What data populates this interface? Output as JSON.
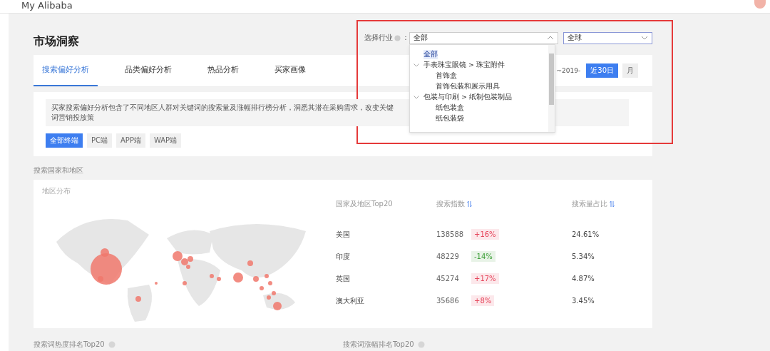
{
  "topbar": {
    "title": "My Alibaba"
  },
  "page": {
    "title": "市场洞察"
  },
  "industry_filter": {
    "label": "选择行业",
    "separator": "：",
    "value": "全部",
    "expanded": true
  },
  "region_filter": {
    "value": "全球"
  },
  "industry_options": [
    {
      "label": "全部",
      "selected": true
    },
    {
      "label": "手表珠宝眼镜 > 珠宝附件",
      "selected": false,
      "children": [
        {
          "label": "首饰盒",
          "selected": false
        },
        {
          "label": "首饰包装和展示用具",
          "selected": false
        }
      ]
    },
    {
      "label": "包装与印刷 > 纸制包装制品",
      "selected": false,
      "children": [
        {
          "label": "纸包装盒",
          "selected": false
        },
        {
          "label": "纸包装袋",
          "selected": false
        }
      ]
    }
  ],
  "tabs": [
    {
      "label": "搜索偏好分析",
      "selected": true
    },
    {
      "label": "品类偏好分析",
      "selected": false
    },
    {
      "label": "热品分析",
      "selected": false
    },
    {
      "label": "买家画像",
      "selected": false
    }
  ],
  "date_range": {
    "text": "~2019-"
  },
  "period_buttons": [
    {
      "label": "近30日",
      "selected": true
    },
    {
      "label": "月",
      "selected": false
    }
  ],
  "description": "买家搜索偏好分析包含了不同地区人群对关键词的搜索量及涨幅排行榜分析，洞悉其潜在采购需求，改变关键词营销投放策",
  "terminals": [
    {
      "label": "全部终端",
      "selected": true
    },
    {
      "label": "PC端",
      "selected": false
    },
    {
      "label": "APP端",
      "selected": false
    },
    {
      "label": "WAP端",
      "selected": false
    }
  ],
  "region_section": {
    "title": "搜索国家和地区",
    "map_title": "地区分布",
    "columns": [
      "国家及地区Top20",
      "搜索指数",
      "搜索量占比"
    ],
    "rows": [
      {
        "country": "美国",
        "index": "138588",
        "change": "+16%",
        "color": "#e6455b",
        "share": "24.61%"
      },
      {
        "country": "印度",
        "index": "48229",
        "change": "-14%",
        "color": "#3fa03a",
        "share": "5.34%"
      },
      {
        "country": "英国",
        "index": "45274",
        "change": "+17%",
        "color": "#e6455b",
        "share": "4.87%"
      },
      {
        "country": "澳大利亚",
        "index": "35686",
        "change": "+8%",
        "color": "#e6455b",
        "share": "3.45%"
      }
    ]
  },
  "bottom_sections": [
    {
      "title": "搜索词热度排名Top20"
    },
    {
      "title": "搜索词涨幅排名Top20"
    }
  ]
}
